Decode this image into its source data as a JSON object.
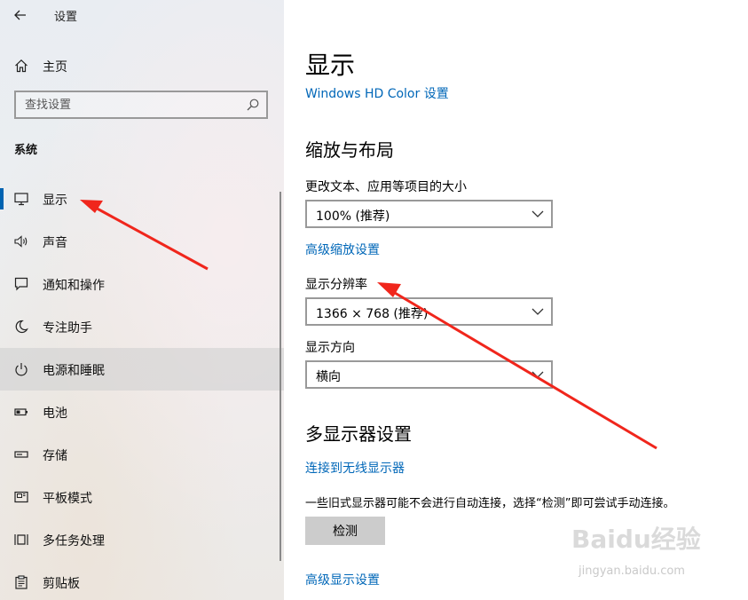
{
  "window": {
    "title": "设置"
  },
  "sidebar": {
    "home_label": "主页",
    "search_placeholder": "查找设置",
    "section": "系统",
    "items": [
      {
        "label": "显示",
        "icon": "monitor-icon",
        "selected": true
      },
      {
        "label": "声音",
        "icon": "speaker-icon"
      },
      {
        "label": "通知和操作",
        "icon": "message-icon"
      },
      {
        "label": "专注助手",
        "icon": "moon-icon"
      },
      {
        "label": "电源和睡眠",
        "icon": "power-icon",
        "hovered": true
      },
      {
        "label": "电池",
        "icon": "battery-icon"
      },
      {
        "label": "存储",
        "icon": "storage-icon"
      },
      {
        "label": "平板模式",
        "icon": "tablet-icon"
      },
      {
        "label": "多任务处理",
        "icon": "multitask-icon"
      },
      {
        "label": "剪贴板",
        "icon": "clipboard-icon"
      }
    ]
  },
  "main": {
    "title": "显示",
    "hdr_link": "Windows HD Color 设置",
    "scale_heading": "缩放与布局",
    "scale_label": "更改文本、应用等项目的大小",
    "scale_value": "100% (推荐)",
    "advanced_scale_link": "高级缩放设置",
    "resolution_label": "显示分辨率",
    "resolution_value": "1366 × 768 (推荐)",
    "orientation_label": "显示方向",
    "orientation_value": "横向",
    "multi_heading": "多显示器设置",
    "wireless_link": "连接到无线显示器",
    "multi_info": "一些旧式显示器可能不会进行自动连接，选择“检测”即可尝试手动连接。",
    "detect_button": "检测",
    "advanced_display_link": "高级显示设置"
  },
  "watermark": {
    "text": "Baidu经验",
    "url": "jingyan.baidu.com"
  },
  "colors": {
    "accent": "#0063b1",
    "link": "#0067b8",
    "arrow": "#f0261c"
  }
}
